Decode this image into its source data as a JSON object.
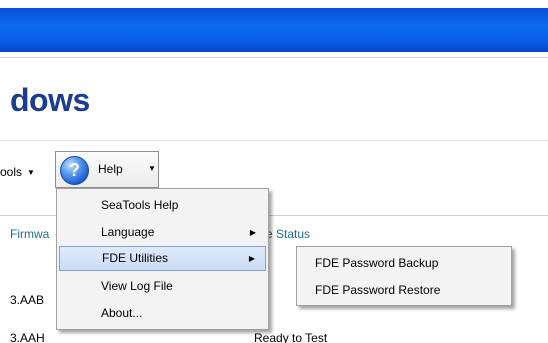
{
  "window": {
    "app_title_fragment": "dows"
  },
  "toolbar": {
    "tools_label": "ools",
    "help_label": "Help",
    "help_icon_glyph": "?"
  },
  "table": {
    "headers": [
      "Firmwa",
      "ve Status"
    ],
    "rows": [
      [
        "3.AAB",
        ""
      ],
      [
        "3.AAH",
        "Ready to Test"
      ]
    ]
  },
  "help_menu": {
    "items": [
      {
        "label": "SeaTools Help",
        "has_submenu": false
      },
      {
        "label": "Language",
        "has_submenu": true
      },
      {
        "label": "FDE Utilities",
        "has_submenu": true,
        "highlighted": true
      },
      {
        "label": "View Log File",
        "has_submenu": false
      },
      {
        "label": "About...",
        "has_submenu": false
      }
    ]
  },
  "fde_submenu": {
    "items": [
      {
        "label": "FDE Password Backup"
      },
      {
        "label": "FDE Password Restore"
      }
    ]
  },
  "glyphs": {
    "dropdown_caret": "▼",
    "submenu_arrow": "▶"
  },
  "colors": {
    "titlebar": "#0b6cf0",
    "app_title": "#1c3c92",
    "column_header": "#1e6f86",
    "menu_highlight": "#c9dcf5"
  }
}
